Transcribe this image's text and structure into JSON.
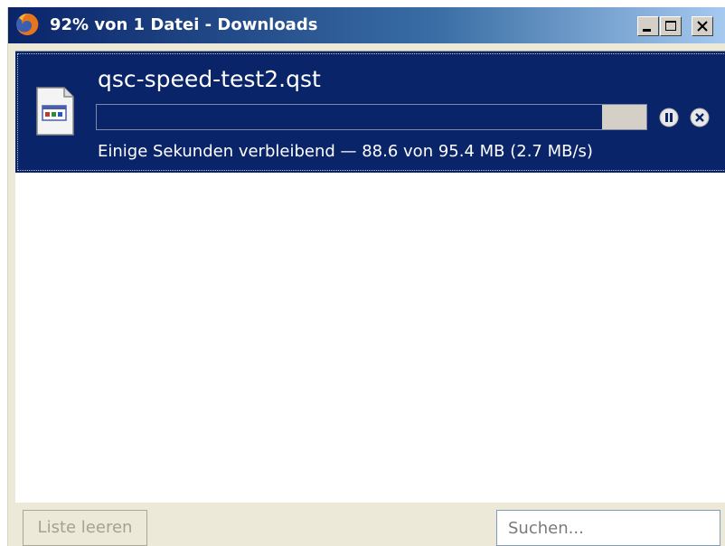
{
  "window": {
    "title": "92% von 1 Datei - Downloads"
  },
  "download": {
    "file_name": "qsc-speed-test2.qst",
    "progress_fraction": 0.92,
    "status": "Einige Sekunden verbleibend — 88.6 von 95.4 MB (2.7 MB/s)"
  },
  "footer": {
    "clear_list_label": "Liste leeren",
    "search_placeholder": "Suchen..."
  },
  "icons": {
    "app": "firefox-icon",
    "file": "file-icon",
    "pause": "pause-icon",
    "cancel": "cancel-icon",
    "minimize": "minimize-icon",
    "maximize": "maximize-icon",
    "close": "close-icon"
  },
  "colors": {
    "titlebar_start": "#0a246a",
    "titlebar_end": "#a6caf0",
    "selection": "#0a246a",
    "progress_track": "#d4d0c8"
  }
}
